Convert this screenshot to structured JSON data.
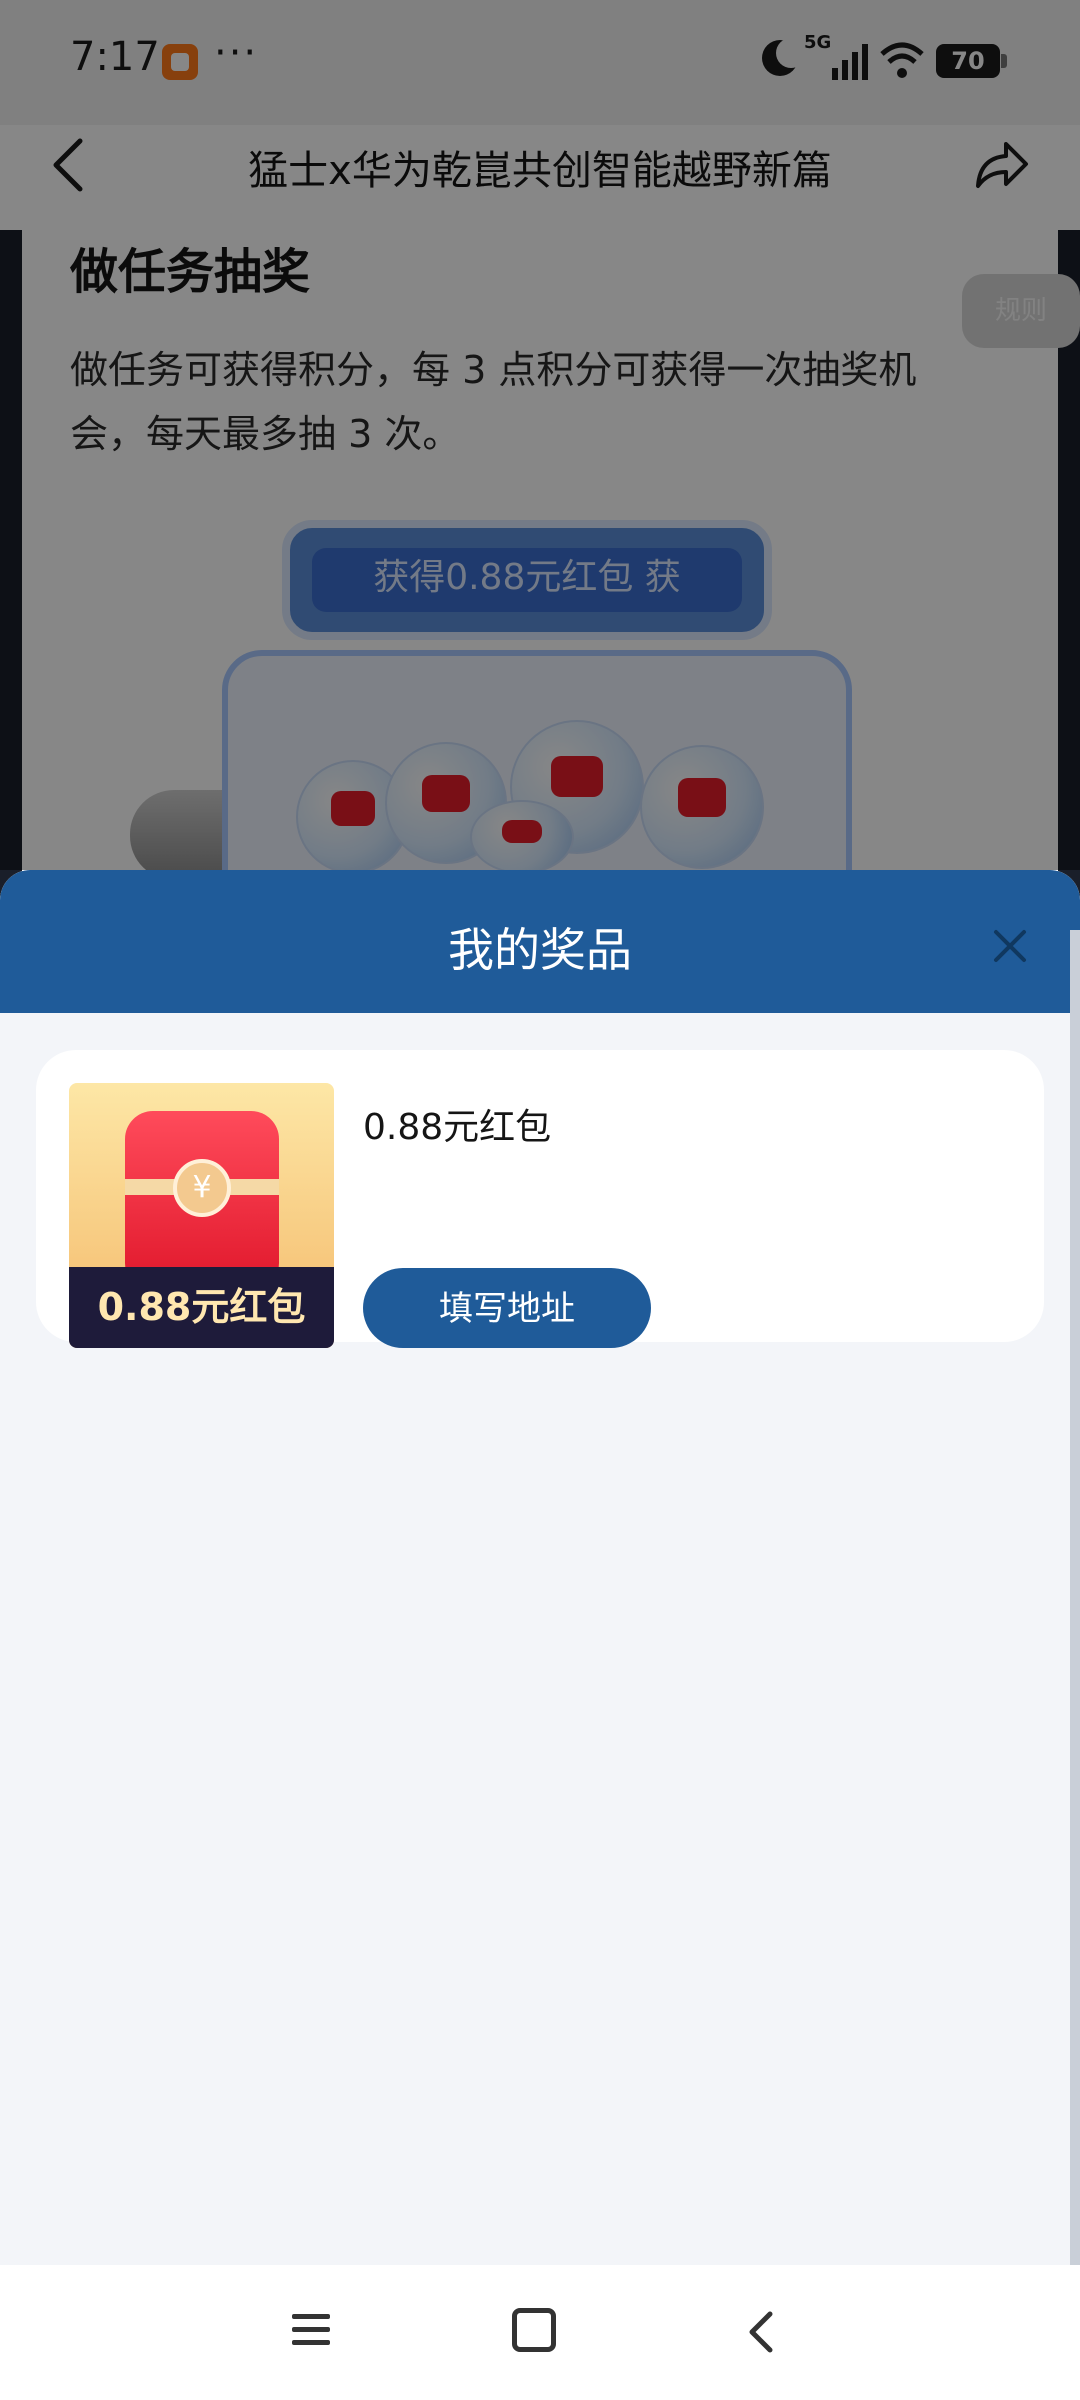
{
  "status_bar": {
    "time": "7:17",
    "more": "···",
    "signal_label": "5G",
    "battery": "70",
    "icons": [
      "app-notification-icon",
      "moon-icon",
      "signal-icon",
      "wifi-icon",
      "battery-icon"
    ]
  },
  "nav": {
    "title": "猛士x华为乾崑共创智能越野新篇",
    "back_icon": "back-arrow-icon",
    "share_icon": "share-icon"
  },
  "background_page": {
    "section_title": "做任务抽奖",
    "rules_label": "规则",
    "description": "做任务可获得积分，每 3 点积分可获得一次抽奖机会，每天最多抽 3 次。",
    "ticker_text": "获得0.88元红包   获"
  },
  "prize_sheet": {
    "title": "我的奖品",
    "close_icon": "close-icon",
    "prizes": [
      {
        "name": "0.88元红包",
        "image_label": "0.88元红包",
        "coin_symbol": "¥",
        "action_label": "填写地址"
      }
    ]
  },
  "system_nav": {
    "icons": [
      "menu-icon",
      "home-icon",
      "back-icon"
    ]
  },
  "colors": {
    "header_blue": "#1f5b99",
    "button_blue": "#1f5b99",
    "sheet_bg": "#f3f5f9"
  }
}
